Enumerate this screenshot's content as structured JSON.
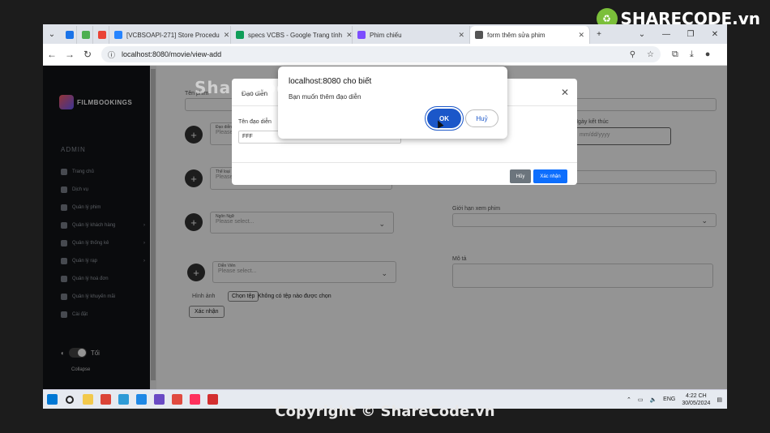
{
  "browser": {
    "tabs": [
      {
        "label": "",
        "color": "#1a73e8"
      },
      {
        "label": "",
        "color": "#4caf50"
      },
      {
        "label": "",
        "color": "#ea4335"
      },
      {
        "label": "[VCBSOAPI-271] Store Procedu",
        "color": "#2684ff"
      },
      {
        "label": "specs VCBS - Google Trang tính",
        "color": "#0f9d58"
      },
      {
        "label": "Phim chiếu",
        "color": "#7c4dff"
      },
      {
        "label": "form thêm sửa phim",
        "color": "#555555",
        "active": true
      }
    ],
    "url": "localhost:8080/movie/view-add"
  },
  "sidebar": {
    "brand": "FILMBOOKINGS",
    "section": "ADMIN",
    "items": [
      {
        "label": "Trang chủ",
        "icon": "home-icon"
      },
      {
        "label": "Dịch vụ",
        "icon": "utensils-icon"
      },
      {
        "label": "Quản lý phim",
        "icon": "film-icon"
      },
      {
        "label": "Quản lý khách hàng",
        "icon": "users-icon",
        "arrow": "›"
      },
      {
        "label": "Quản lý thống kê",
        "icon": "chart-icon",
        "arrow": "›"
      },
      {
        "label": "Quản lý rạp",
        "icon": "building-icon",
        "arrow": "›"
      },
      {
        "label": "Quản lý hoá đơn",
        "icon": "receipt-icon"
      },
      {
        "label": "Quản lý khuyến mãi",
        "icon": "gift-icon"
      },
      {
        "label": "Cài đặt",
        "icon": "gear-icon"
      }
    ],
    "theme_label": "Tối",
    "collapse_label": "Collapse"
  },
  "form": {
    "movie_name_label": "Tên phim",
    "director_field_label": "Đạo diễn",
    "director_placeholder": "Please select...",
    "genre_field_label": "Thể loại",
    "genre_placeholder": "Please select...",
    "language_field_label": "Ngôn Ngữ",
    "language_placeholder": "Please select...",
    "actor_field_label": "Diễn Viên",
    "actor_placeholder": "Please select...",
    "end_date_label": "Ngày kết thúc",
    "end_date_placeholder": "mm/dd/yyyy",
    "age_limit_label": "Giới hạn xem phim",
    "description_label": "Mô tả",
    "image_label": "Hình ảnh",
    "choose_file_button": "Chọn tệp",
    "no_file_text": "Không có tệp nào được chọn",
    "submit_button": "Xác nhận"
  },
  "modal": {
    "title": "Đạo diễn",
    "director_name_label": "Tên đạo diễn",
    "director_name_value": "FFF",
    "cancel_button": "Hủy",
    "confirm_button": "Xác nhận"
  },
  "alert": {
    "title": "localhost:8080 cho biết",
    "message": "Bạn muốn thêm đạo diễn",
    "ok_button": "OK",
    "cancel_button": "Huỷ"
  },
  "taskbar": {
    "icons": [
      {
        "name": "start-icon",
        "color": "#0078d4"
      },
      {
        "name": "search-icon",
        "color": "#222222"
      },
      {
        "name": "file-explorer-icon",
        "color": "#f2c94c"
      },
      {
        "name": "chrome-icon",
        "color": "#db4437"
      },
      {
        "name": "photos-icon",
        "color": "#2e9bd6"
      },
      {
        "name": "remote-desktop-icon",
        "color": "#1e88e5"
      },
      {
        "name": "app-icon",
        "color": "#6a4bc4"
      },
      {
        "name": "unikey-icon",
        "color": "#e04a3f"
      },
      {
        "name": "intellij-icon",
        "color": "#fe315d"
      },
      {
        "name": "recorder-icon",
        "color": "#d32f2f"
      }
    ],
    "language": "ENG",
    "time": "4:22 CH",
    "date": "30/05/2024"
  },
  "watermark": {
    "brand": "SHARECODE.vn",
    "center": "ShareCode.vn",
    "copyright": "Copyright © ShareCode.vn"
  }
}
